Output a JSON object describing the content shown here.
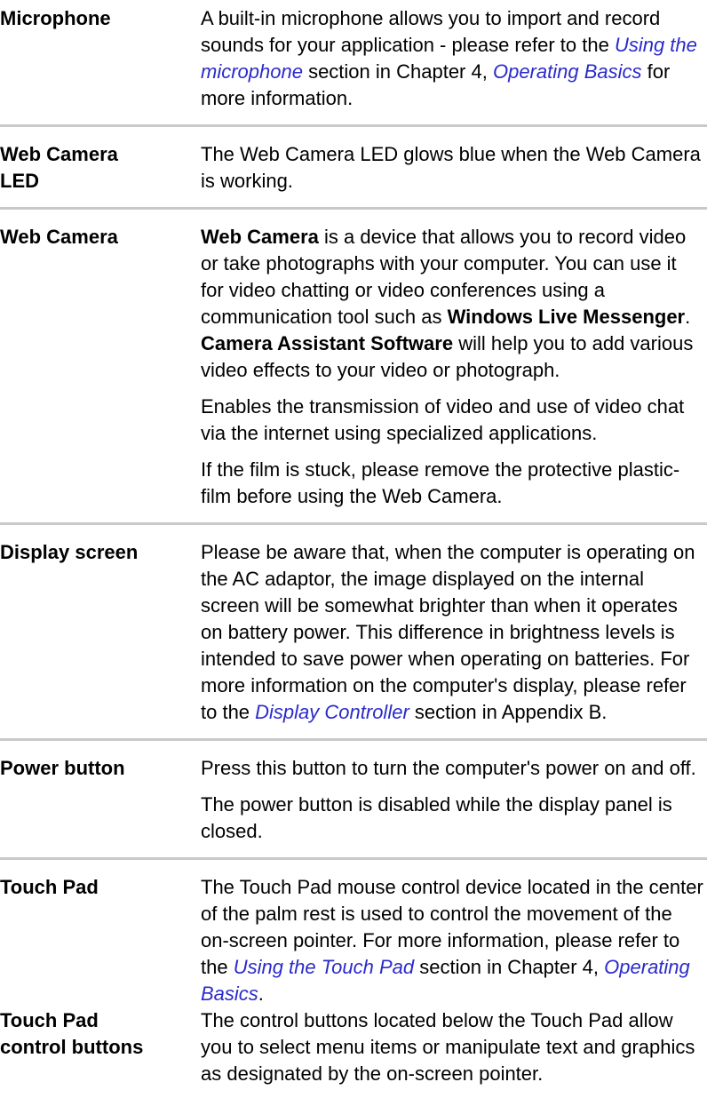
{
  "entries": [
    {
      "term": "Microphone",
      "p1": {
        "t1": "A built-in microphone allows you to import and record sounds for your application - please refer to the ",
        "link1": "Using the microphone",
        "t2": " section in Chapter 4, ",
        "link2": "Operating Basics",
        "t3": " for more information."
      }
    },
    {
      "term": "Web Camera LED",
      "p1": "The Web Camera LED glows blue when the Web Camera is working."
    },
    {
      "term": "Web Camera",
      "p1": {
        "b1": "Web Camera",
        "t1": " is a device that allows you to record video or take photographs with your computer. You can use it for video chatting or video conferences using a communication tool such as ",
        "b2": "Windows Live Messenger",
        "t2": ". ",
        "b3": "Camera Assistant Software",
        "t3": " will help you to add various video effects to your video or photograph."
      },
      "p2": "Enables the transmission of video and use of video chat via the internet using specialized applications.",
      "p3": "If the film is stuck, please remove the protective plastic-film before using the Web Camera."
    },
    {
      "term": "Display screen",
      "p1": {
        "t1": "Please be aware that, when the computer is operating on the AC adaptor, the image displayed on the internal screen will be somewhat brighter than when it operates on battery power. This difference in brightness levels is intended to save power when operating on batteries. For more information on the computer's display, please refer to the ",
        "link1": "Display Controller",
        "t2": " section in Appendix B."
      }
    },
    {
      "term": "Power button",
      "p1": "Press this button to turn the computer's power on and off.",
      "p2": "The power button is disabled while the display panel is closed."
    },
    {
      "term": "Touch Pad",
      "p1": {
        "t1": "The Touch Pad mouse control device located in the center of the palm rest is used to control the movement of the on-screen pointer. For more information, please refer to the ",
        "link1": "Using the Touch Pad",
        "t2": " section in Chapter 4, ",
        "link2": "Operating Basics",
        "t3": "."
      }
    },
    {
      "term": "Touch Pad control buttons",
      "p1": "The control buttons located below the Touch Pad allow you to select menu items or manipulate text and graphics as designated by the on-screen pointer."
    }
  ],
  "colors": {
    "link": "#2a2acc",
    "separator": "#c9c9c9",
    "text": "#000000"
  }
}
